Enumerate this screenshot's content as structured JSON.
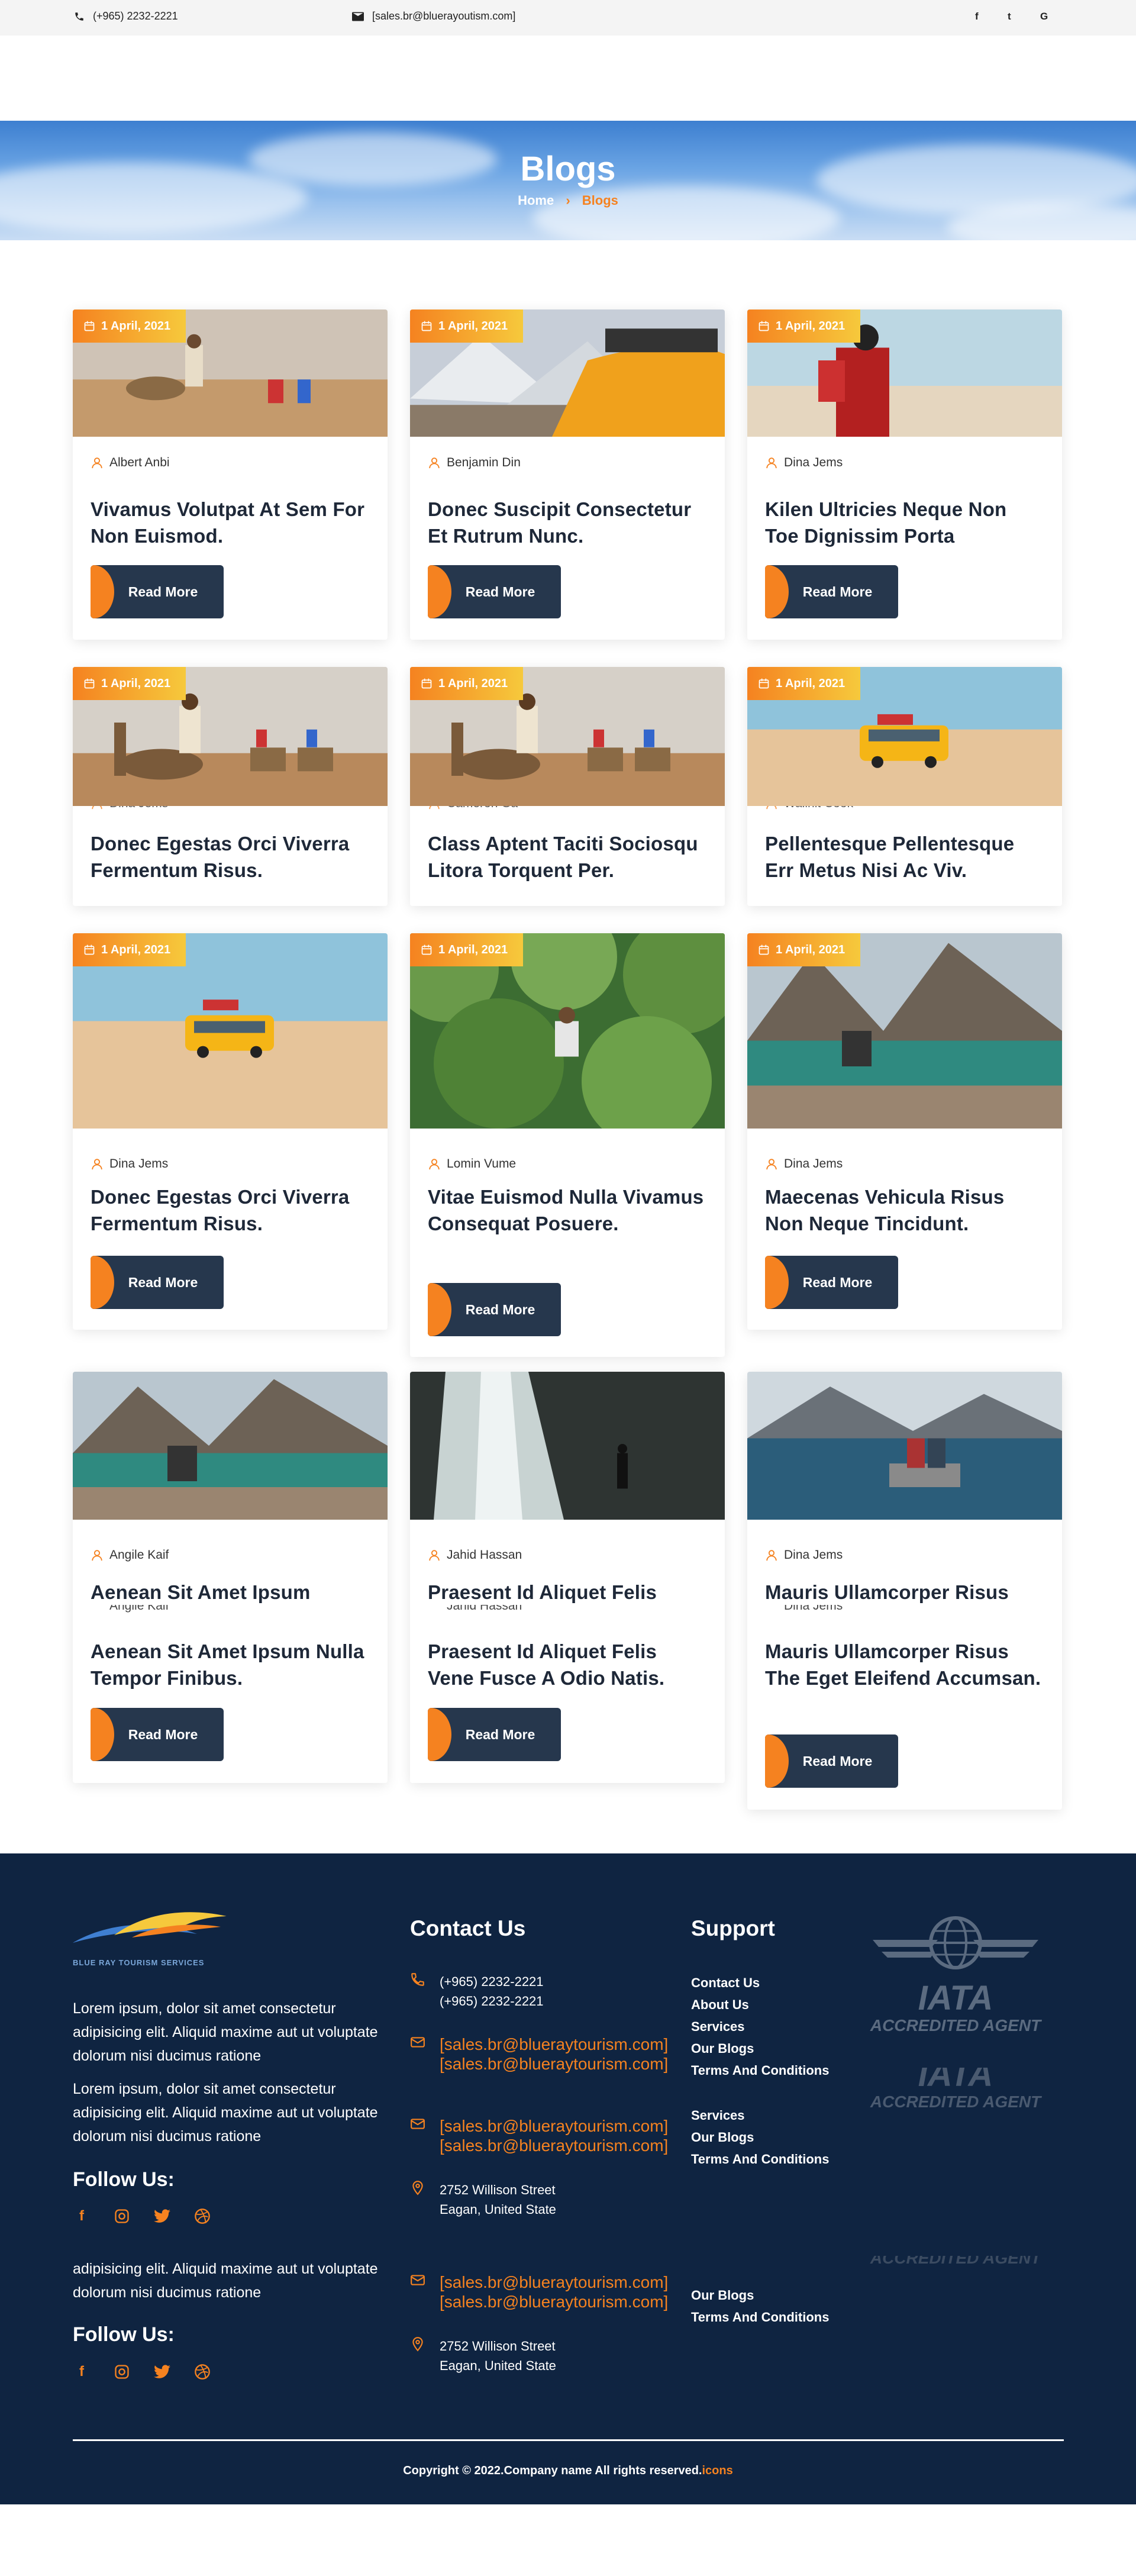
{
  "topbar": {
    "phone": "(+965) 2232-2221",
    "email": "[sales.br@bluerayoutism.com]",
    "social": [
      "f",
      "t",
      "G"
    ]
  },
  "hero": {
    "title": "Blogs",
    "crumb_home": "Home",
    "crumb_sep": "›",
    "crumb_current": "Blogs"
  },
  "cards": [
    {
      "date": "1 April, 2021",
      "author": "Albert Anbi",
      "title": "Vivamus Volutpat At Sem For Non Euismod.",
      "button": "Read More"
    },
    {
      "date": "1 April, 2021",
      "author": "Benjamin Din",
      "title": "Donec Suscipit Consectetur Et Rutrum Nunc.",
      "button": "Read More"
    },
    {
      "date": "1 April, 2021",
      "author": "Dina Jems",
      "title": "Kilen Ultricies Neque Non Toe Dignissim Porta",
      "button": "Read More"
    },
    {
      "date": "1 April, 2021",
      "author": "Dina Jems",
      "title": "Donec Egestas Orci Viverra Fermentum Risus.",
      "button": "Read More"
    },
    {
      "date": "1 April, 2021",
      "author": "Cameron Ga",
      "title": "Class Aptent Taciti Sociosqu Litora Torquent Per.",
      "button": "Read More"
    },
    {
      "date": "1 April, 2021",
      "author": "Wallnit Cook",
      "title": "Pellentesque Pellentesque Err Metus Nisi Ac Viv.",
      "button": "Read More"
    },
    {
      "date": "1 April, 2021",
      "author": "Dina Jems",
      "title": "Donec Egestas Orci Viverra Fermentum Risus.",
      "button": "Read More"
    },
    {
      "date": "1 April, 2021",
      "author": "Lomin Vume",
      "title": "Vitae Euismod Nulla Vivamus Consequat Posuere.",
      "button": "Read More"
    },
    {
      "date": "1 April, 2021",
      "author": "Dina Jems",
      "title": "Maecenas Vehicula Risus Non Neque Tincidunt.",
      "button": "Read More"
    },
    {
      "date": "",
      "author": "Angile Kaif",
      "title_top": "Aenean Sit Amet Ipsum",
      "title": "Aenean Sit Amet Ipsum Nulla Tempor Finibus.",
      "button": "Read More"
    },
    {
      "date": "",
      "author": "Jahid Hassan",
      "title_top": "Praesent Id Aliquet Felis",
      "title": "Praesent Id Aliquet Felis Vene Fusce A Odio Natis.",
      "button": "Read More"
    },
    {
      "date": "",
      "author": "Dina Jems",
      "title_top": "Mauris Ullamcorper Risus",
      "title": "Mauris Ullamcorper Risus The Eget Eleifend Accumsan.",
      "button": "Read More"
    }
  ],
  "footer": {
    "brand": "BLUE RAY TOURISM SERVICES",
    "about": "Lorem ipsum, dolor sit amet consectetur adipisicing elit. Aliquid maxime aut ut voluptate dolorum nisi ducimus ratione",
    "follow": "Follow Us:",
    "contact_heading": "Contact Us",
    "phone1": "(+965) 2232-2221",
    "phone2": "(+965) 2232-2221",
    "email1": "[sales.br@blueraytourism.com]",
    "email2": "[sales.br@blueraytourism.com]",
    "address1": "2752 Willison Street",
    "address2": "Eagan, United State",
    "support_heading": "Support",
    "support_links": [
      "Contact Us",
      "About Us",
      "Services",
      "Our Blogs",
      "Terms And Conditions"
    ],
    "iata_title": "IATA",
    "iata_sub": "ACCREDITED AGENT",
    "copyright": "Copyright © 2022.Company name All rights reserved.",
    "copyright_link": "icons"
  }
}
